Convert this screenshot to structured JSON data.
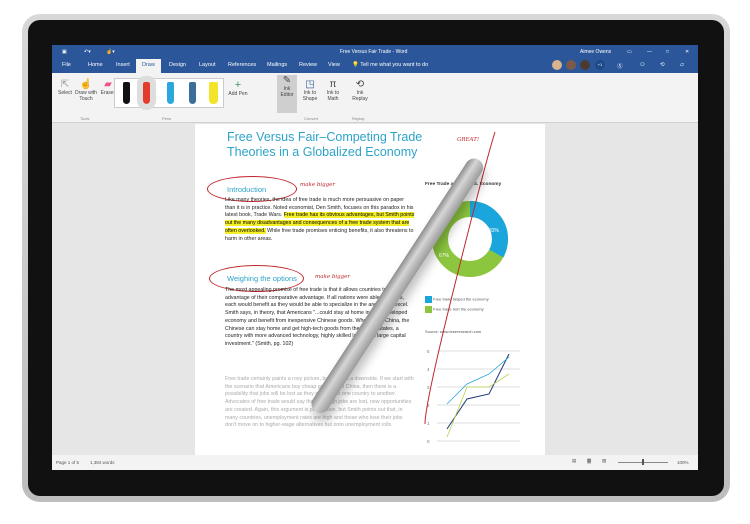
{
  "window": {
    "title": "Free Versus Fair Trade - Word",
    "user": "Aimee Owens",
    "coauthors_extra": "+1"
  },
  "tabs": [
    "File",
    "Home",
    "Insert",
    "Draw",
    "Design",
    "Layout",
    "References",
    "Mailings",
    "Review",
    "View"
  ],
  "tell_me": "Tell me what you want to do",
  "ribbon": {
    "select": "Select",
    "draw_touch": "Draw with Touch",
    "eraser": "Eraser",
    "add_pen": "Add Pen",
    "ink_editor": "Ink Editor",
    "ink_shape": "Ink to Shape",
    "ink_math": "Ink to Math",
    "ink_replay": "Ink Replay",
    "groups": [
      "Tools",
      "Pens",
      "Convert",
      "Replay"
    ]
  },
  "pens": {
    "colors": [
      "#111111",
      "#e23b2e",
      "#2aa7dc",
      "#3b6f9a",
      "#f3e42a"
    ]
  },
  "document": {
    "title": "Free Versus Fair–Competing Trade Theories in a Globalized Economy",
    "h_intro": "Introduction",
    "p1_a": "Like many theories, the idea of free trade is much more persuasive on paper than it is in practice. Noted economist, Den Smith, focuses on this paradox in his latest book, Trade Wars. ",
    "p1_hl": "Free trade has its obvious advantages, but Smith points out the many disadvantages and consequences of a free trade system that are often overlooked.",
    "p1_b": " While free trade promises enticing benefits, it also threatens to harm in other areas.",
    "h_options": "Weighing the options",
    "p2": "The most appealing promise of free trade is that it allows countries to take advantage of their comparative advantage. If all nations were able to do this, each would benefit as they would be able to specialize in the areas they excel. Smith says, in theory, that Americans \"...could stay at home in their developed economy and benefit from inexpensive Chinese goods. Whereas, in China, the Chinese can stay home and get high-tech goods from the United States, a country with more advanced technology, highly skilled labor, and large capital investment.\" (Smith, pg. 102)",
    "p3": "Free trade certainly paints a rosy picture, but there is a downside. If we start with the scenario that Americans buy cheap goods from China, then there is a possibility that jobs will be lost as they move from one country to another. Advocates of free trade would say that although jobs are lost, new opportunities are created. Again, this argument is persuasive, but Smith points out that, in many countries, unemployment rates are high and those who lose their jobs don't move on to higher-wage alternatives but onto unemployment rolls.",
    "ink_make_bigger": "make bigger",
    "ink_great": "GREAT!",
    "chart_title": "Free Trade and the U.S. Economy",
    "donut": {
      "helped_pct": "33%",
      "hurt_pct": "67%",
      "helped_value": 33,
      "hurt_value": 67,
      "helped_color": "#1aa6dd",
      "hurt_color": "#8cc63f"
    },
    "legend": [
      "Free trade helped the economy",
      "Free trade hurt the economy"
    ],
    "source": "Source: www.teseresearch.com",
    "line_ticks": [
      "5",
      "4",
      "3",
      "2",
      "1",
      "0"
    ]
  },
  "status": {
    "page": "Page 1 of 5",
    "words": "1,384 words",
    "zoom": "100%"
  }
}
